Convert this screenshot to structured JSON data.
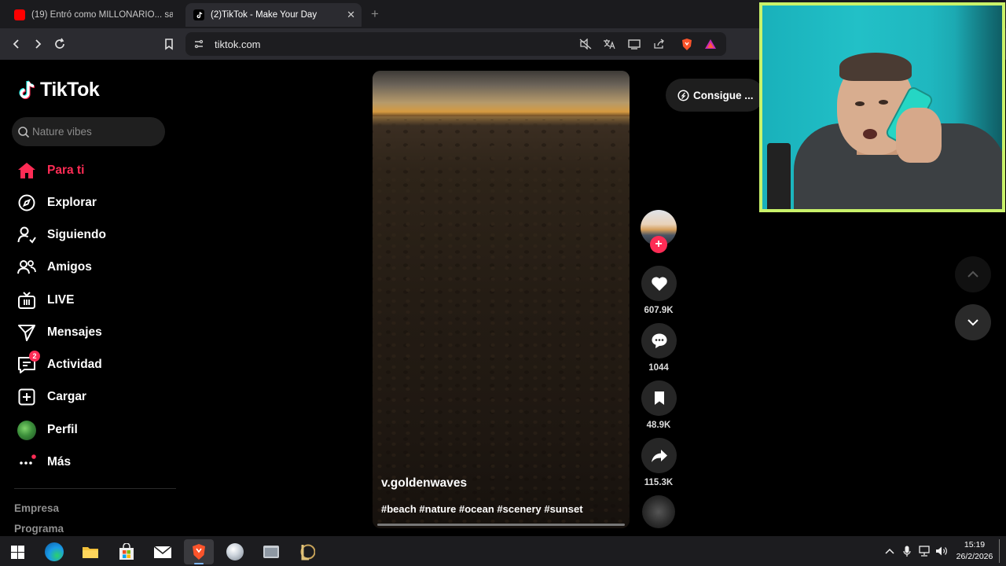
{
  "browser": {
    "tabs": [
      {
        "title": "(19) Entró como MILLONARIO... salió",
        "favicon_color": "#ff0000",
        "active": false
      },
      {
        "title": "(2)TikTok - Make Your Day",
        "favicon_color": "#000000",
        "active": true
      }
    ],
    "close_tab_glyph": "✕",
    "new_tab_glyph": "+",
    "url": "tiktok.com"
  },
  "sidebar": {
    "logo_text": "TikTok",
    "search_placeholder": "Nature vibes",
    "items": [
      {
        "label": "Para ti",
        "icon": "home-icon",
        "active": true
      },
      {
        "label": "Explorar",
        "icon": "compass-icon"
      },
      {
        "label": "Siguiendo",
        "icon": "following-icon"
      },
      {
        "label": "Amigos",
        "icon": "friends-icon"
      },
      {
        "label": "LIVE",
        "icon": "live-icon"
      },
      {
        "label": "Mensajes",
        "icon": "messages-icon"
      },
      {
        "label": "Actividad",
        "icon": "activity-icon",
        "badge": "2"
      },
      {
        "label": "Cargar",
        "icon": "upload-icon"
      },
      {
        "label": "Perfil",
        "icon": "profile-avatar-icon"
      },
      {
        "label": "Más",
        "icon": "more-icon"
      }
    ],
    "footer_links": [
      "Empresa",
      "Programa"
    ]
  },
  "video": {
    "author": "v.goldenwaves",
    "hashtags": "#beach #nature #ocean #scenery #sunset",
    "follow_glyph": "+",
    "likes": "607.9K",
    "comments": "1044",
    "saves": "48.9K",
    "shares": "115.3K"
  },
  "get_app_label": "Consigue ...",
  "taskbar": {
    "time": "15:19",
    "date": "26/2/2026"
  },
  "colors": {
    "accent": "#fe2c55",
    "chrome_bg": "#2b2b30",
    "tabbar_bg": "#1b1b1e",
    "webcam_border": "#c9f26a"
  }
}
